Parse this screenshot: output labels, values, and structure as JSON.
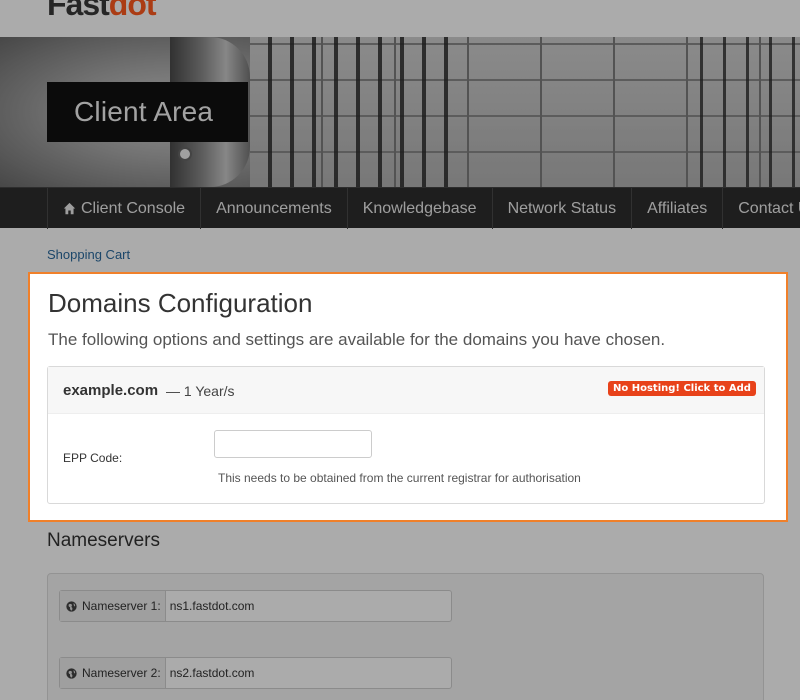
{
  "brand": {
    "logo_main": "Fast",
    "logo_accent": "dot"
  },
  "banner": {
    "title": "Client Area"
  },
  "nav": {
    "items": [
      {
        "label": "Client Console",
        "icon": "home-icon"
      },
      {
        "label": "Announcements"
      },
      {
        "label": "Knowledgebase"
      },
      {
        "label": "Network Status"
      },
      {
        "label": "Affiliates"
      },
      {
        "label": "Contact Us"
      }
    ]
  },
  "breadcrumb": {
    "label": "Shopping Cart"
  },
  "domains_config": {
    "title": "Domains Configuration",
    "subtitle": "The following options and settings are available for the domains you have chosen.",
    "domain": {
      "name": "example.com",
      "period": "— 1 Year/s",
      "badge": "No Hosting! Click to Add",
      "epp_label": "EPP Code:",
      "epp_value": "",
      "epp_help": "This needs to be obtained from the current registrar for authorisation"
    }
  },
  "nameservers": {
    "title": "Nameservers",
    "items": [
      {
        "label": "Nameserver 1:",
        "value": "ns1.fastdot.com"
      },
      {
        "label": "Nameserver 2:",
        "value": "ns2.fastdot.com"
      }
    ]
  },
  "colors": {
    "highlight_border": "#f0802a",
    "badge": "#e8421a",
    "link": "#2a6a9e"
  }
}
